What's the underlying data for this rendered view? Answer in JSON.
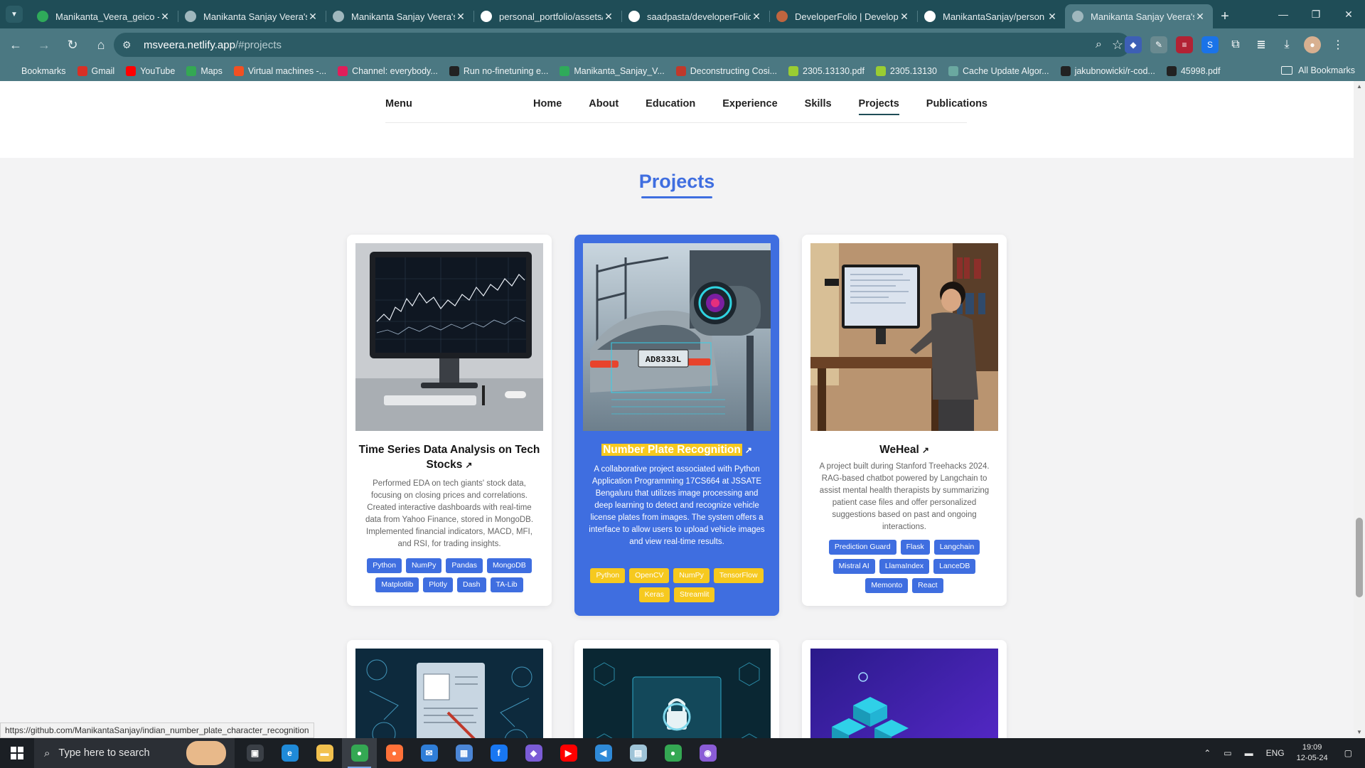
{
  "browser": {
    "tabs": [
      {
        "title": "Manikanta_Veera_geico -",
        "favicon": "leaf-icon",
        "color": "#2faa5a",
        "active": false
      },
      {
        "title": "Manikanta Sanjay Veera's",
        "favicon": "globe-icon",
        "color": "#9fb7bd",
        "active": false
      },
      {
        "title": "Manikanta Sanjay Veera's",
        "favicon": "globe-icon",
        "color": "#9fb7bd",
        "active": false
      },
      {
        "title": "personal_portfolio/assets/",
        "favicon": "github-icon",
        "color": "#ffffff",
        "active": false
      },
      {
        "title": "saadpasta/developerFolio",
        "favicon": "github-icon",
        "color": "#ffffff",
        "active": false
      },
      {
        "title": "DeveloperFolio | Develop",
        "favicon": "avatar-icon",
        "color": "#c0653f",
        "active": false
      },
      {
        "title": "ManikantaSanjay/person",
        "favicon": "github-icon",
        "color": "#ffffff",
        "active": false
      },
      {
        "title": "Manikanta Sanjay Veera's",
        "favicon": "globe-icon",
        "color": "#9fb7bd",
        "active": true
      }
    ],
    "url_host": "msveera.netlify.app",
    "url_path": "/#projects",
    "bookmarks": [
      {
        "label": "Bookmarks",
        "icon": "star-icon",
        "color": "#4b7882"
      },
      {
        "label": "Gmail",
        "icon": "gmail-icon",
        "color": "#d93025"
      },
      {
        "label": "YouTube",
        "icon": "youtube-icon",
        "color": "#ff0000"
      },
      {
        "label": "Maps",
        "icon": "maps-icon",
        "color": "#34a853"
      },
      {
        "label": "Virtual machines -...",
        "icon": "microsoft-icon",
        "color": "#f25022"
      },
      {
        "label": "Channel: everybody...",
        "icon": "slack-icon",
        "color": "#e01e5a"
      },
      {
        "label": "Run no-finetuning e...",
        "icon": "wandb-icon",
        "color": "#222222"
      },
      {
        "label": "Manikanta_Sanjay_V...",
        "icon": "leaf-icon",
        "color": "#2faa5a"
      },
      {
        "label": "Deconstructing Cosi...",
        "icon": "doc-icon",
        "color": "#c0392b"
      },
      {
        "label": "2305.13130.pdf",
        "icon": "pdf-smile-icon",
        "color": "#9acd32"
      },
      {
        "label": "2305.13130",
        "icon": "pdf-smile-icon",
        "color": "#9acd32"
      },
      {
        "label": "Cache Update Algor...",
        "icon": "openai-icon",
        "color": "#6aa8a0"
      },
      {
        "label": "jakubnowicki/r-cod...",
        "icon": "github-icon",
        "color": "#222222"
      },
      {
        "label": "45998.pdf",
        "icon": "globe-icon",
        "color": "#222222"
      }
    ],
    "all_bookmarks": "All Bookmarks",
    "status_url": "https://github.com/ManikantaSanjay/indian_number_plate_character_recognition"
  },
  "nav": {
    "menu": "Menu",
    "links": [
      "Home",
      "About",
      "Education",
      "Experience",
      "Skills",
      "Projects",
      "Publications"
    ],
    "active": "Projects"
  },
  "section_title": "Projects",
  "projects": [
    {
      "title": "Time Series Data Analysis on Tech Stocks",
      "description": "Performed EDA on tech giants' stock data, focusing on closing prices and correlations. Created interactive dashboards with real-time data from Yahoo Finance, stored in MongoDB. Implemented financial indicators, MACD, MFI, and RSI, for trading insights.",
      "tags": [
        "Python",
        "NumPy",
        "Pandas",
        "MongoDB",
        "Matplotlib",
        "Plotly",
        "Dash",
        "TA-Lib"
      ],
      "image": "stock-chart-monitor-image"
    },
    {
      "title": "Number Plate Recognition",
      "description": "A collaborative project associated with Python Application Programming 17CS664 at JSSATE Bengaluru that utilizes image processing and deep learning to detect and recognize vehicle license plates from images. The system offers a interface to allow users to upload vehicle images and view real-time results.",
      "tags": [
        "Python",
        "OpenCV",
        "NumPy",
        "TensorFlow",
        "Keras",
        "Streamlit"
      ],
      "image": "license-plate-camera-image",
      "plate_text": "AD8333L",
      "highlighted": true
    },
    {
      "title": "WeHeal",
      "description": "A project built during Stanford Treehacks 2024. RAG-based chatbot powered by Langchain to assist mental health therapists by summarizing patient case files and offer personalized suggestions based on past and ongoing interactions.",
      "tags": [
        "Prediction Guard",
        "Flask",
        "Langchain",
        "Mistral AI",
        "LlamaIndex",
        "LanceDB",
        "Memonto",
        "React"
      ],
      "image": "person-at-computer-image"
    }
  ],
  "taskbar": {
    "search_placeholder": "Type here to search",
    "language": "ENG",
    "time": "19:09",
    "date": "12-05-24",
    "apps": [
      {
        "name": "task-view-icon",
        "color": "#3a3f46",
        "glyph": "▣"
      },
      {
        "name": "edge-icon",
        "color": "#1f8ad8",
        "glyph": "e"
      },
      {
        "name": "file-explorer-icon",
        "color": "#f2c14e",
        "glyph": "▬"
      },
      {
        "name": "chrome-icon",
        "color": "#34a853",
        "glyph": "●",
        "active": true
      },
      {
        "name": "firefox-icon",
        "color": "#ff7139",
        "glyph": "●"
      },
      {
        "name": "mail-icon",
        "color": "#2f7ed8",
        "glyph": "✉"
      },
      {
        "name": "store-icon",
        "color": "#4b86d6",
        "glyph": "▦"
      },
      {
        "name": "facebook-icon",
        "color": "#1877f2",
        "glyph": "f"
      },
      {
        "name": "power-automate-icon",
        "color": "#7b5cd6",
        "glyph": "◆"
      },
      {
        "name": "youtube-app-icon",
        "color": "#ff0000",
        "glyph": "▶"
      },
      {
        "name": "vscode-icon",
        "color": "#2f8ad8",
        "glyph": "◀"
      },
      {
        "name": "notes-app-icon",
        "color": "#9fc4d8",
        "glyph": "▤"
      },
      {
        "name": "chrome-profile-icon",
        "color": "#34a853",
        "glyph": "●"
      },
      {
        "name": "github-desktop-icon",
        "color": "#8a5cd6",
        "glyph": "◉"
      }
    ]
  }
}
